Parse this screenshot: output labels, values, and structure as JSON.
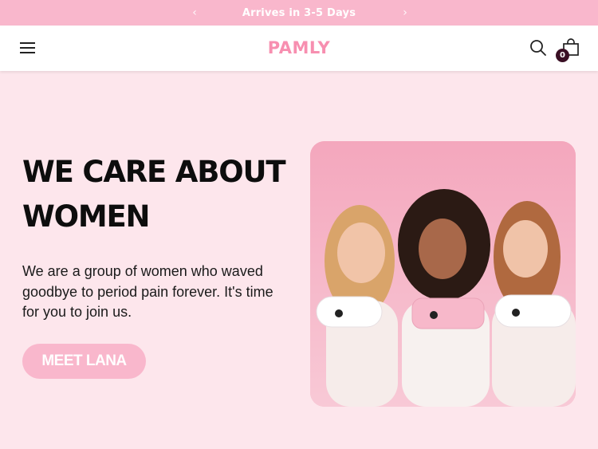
{
  "announcement": {
    "text": "Arrives in 3-5 Days",
    "prev_icon": "chevron-left-icon",
    "next_icon": "chevron-right-icon"
  },
  "header": {
    "logo": "PAMLY",
    "menu_icon": "hamburger-menu-icon",
    "search_icon": "search-icon",
    "cart_icon": "shopping-bag-icon",
    "cart_count": "0"
  },
  "hero": {
    "title": "WE CARE ABOUT WOMEN",
    "text": "We are a group of women who waved goodbye to period pain forever. It's time for you to join us.",
    "cta_label": "MEET LANA",
    "image": "photo-three-women-holding-pain-relief-devices"
  },
  "colors": {
    "brand_pink": "#f78fb0",
    "accent_pink": "#f9b7cc",
    "background": "#fde6ec",
    "badge": "#3a0f24"
  }
}
